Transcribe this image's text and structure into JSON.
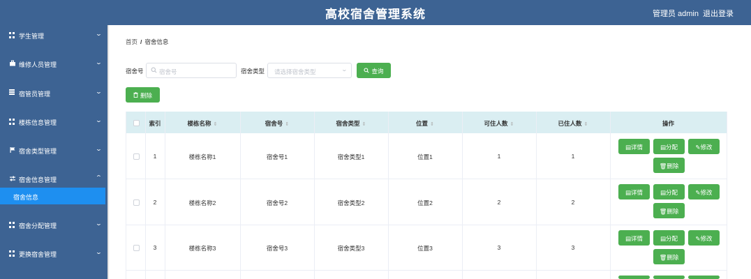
{
  "header": {
    "title": "高校宿舍管理系统",
    "user": "管理员 admin",
    "logout": "退出登录"
  },
  "sidebar": {
    "items": [
      {
        "label": "学生管理",
        "icon": "grid-icon"
      },
      {
        "label": "维修人员管理",
        "icon": "briefcase-icon"
      },
      {
        "label": "宿管员管理",
        "icon": "list-icon"
      },
      {
        "label": "楼栋信息管理",
        "icon": "grid-icon"
      },
      {
        "label": "宿舍类型管理",
        "icon": "flag-icon"
      },
      {
        "label": "宿舍信息管理",
        "icon": "sliders-icon"
      },
      {
        "label": "宿舍分配管理",
        "icon": "grid-icon"
      },
      {
        "label": "更换宿舍管理",
        "icon": "grid-icon"
      }
    ],
    "active_sub": "宿舍信息"
  },
  "breadcrumb": {
    "home": "首页",
    "sep": "/",
    "current": "宿舍信息"
  },
  "search": {
    "room_label": "宿舍号",
    "room_placeholder": "宿舍号",
    "type_label": "宿舍类型",
    "type_placeholder": "请选择宿舍类型",
    "query_button": "查询"
  },
  "delete_button": "删除",
  "table": {
    "columns": [
      "索引",
      "楼栋名称",
      "宿舍号",
      "宿舍类型",
      "位置",
      "可住人数",
      "已住人数",
      "操作"
    ],
    "rows": [
      {
        "index": "1",
        "building": "楼栋名称1",
        "room": "宿舍号1",
        "type": "宿舍类型1",
        "location": "位置1",
        "capacity": "1",
        "occupied": "1"
      },
      {
        "index": "2",
        "building": "楼栋名称2",
        "room": "宿舍号2",
        "type": "宿舍类型2",
        "location": "位置2",
        "capacity": "2",
        "occupied": "2"
      },
      {
        "index": "3",
        "building": "楼栋名称3",
        "room": "宿舍号3",
        "type": "宿舍类型3",
        "location": "位置3",
        "capacity": "3",
        "occupied": "3"
      }
    ],
    "actions": {
      "detail": "详情",
      "assign": "分配",
      "edit": "修改",
      "delete": "删除"
    }
  },
  "colors": {
    "nav": "#3d6393",
    "active": "#1e8ff0",
    "button": "#4caf50",
    "table_header": "#daeef2"
  }
}
